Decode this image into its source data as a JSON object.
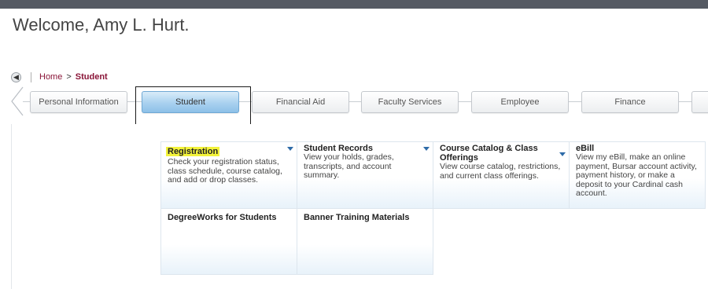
{
  "header": {
    "welcome": "Welcome, Amy L. Hurt."
  },
  "breadcrumb": {
    "home": "Home",
    "separator": ">",
    "current": "Student"
  },
  "tabs": [
    {
      "label": "Personal Information"
    },
    {
      "label": "Student"
    },
    {
      "label": "Financial Aid"
    },
    {
      "label": "Faculty Services"
    },
    {
      "label": "Employee"
    },
    {
      "label": "Finance"
    }
  ],
  "cards": [
    {
      "title": "Registration",
      "description": "Check your registration status, class schedule, course catalog, and add or drop classes."
    },
    {
      "title": "Student Records",
      "description": "View your holds, grades, transcripts, and account summary."
    },
    {
      "title": "Course Catalog & Class Offerings",
      "description": "View course catalog, restrictions, and current class offerings."
    },
    {
      "title": "eBill",
      "description": "View my eBill, make an online payment, Bursar account activity, payment history, or make a deposit to your Cardinal cash account."
    },
    {
      "title": "DegreeWorks for Students",
      "description": ""
    },
    {
      "title": "Banner Training Materials",
      "description": ""
    }
  ],
  "colors": {
    "accent_link": "#8a1538",
    "highlight": "#f3f33a",
    "active_tab": "#a9d1ef",
    "dropdown_caret": "#2e6ba8"
  },
  "icons": {
    "back": "back-arrow-icon",
    "scroll": "chevron-left-icon",
    "dropdown": "caret-down-icon"
  }
}
